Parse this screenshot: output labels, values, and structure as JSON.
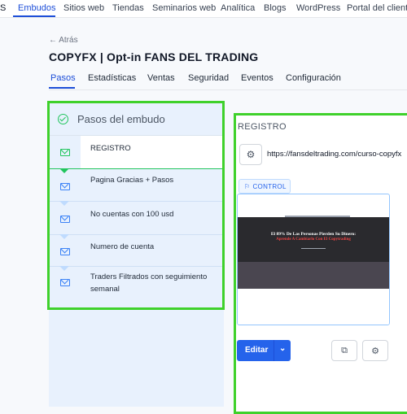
{
  "topnav": {
    "cut_label": "S",
    "items": [
      "Embudos",
      "Sitios web",
      "Tiendas",
      "Seminarios web",
      "Analítica",
      "Blogs",
      "WordPress",
      "Portal del cliente"
    ]
  },
  "page": {
    "back_label": "← Atrás",
    "title": "COPYFX | Opt-in FANS DEL TRADING",
    "tabs": [
      "Pasos",
      "Estadísticas",
      "Ventas",
      "Seguridad",
      "Eventos",
      "Configuración"
    ]
  },
  "steps": {
    "header": "Pasos del embudo",
    "items": [
      {
        "label": "REGISTRO"
      },
      {
        "label": "Pagina Gracias + Pasos"
      },
      {
        "label": "No cuentas con 100 usd"
      },
      {
        "label": "Numero de cuenta"
      },
      {
        "label": "Traders Filtrados con seguimiento semanal"
      }
    ]
  },
  "detail": {
    "title": "REGISTRO",
    "url": "https://fansdeltrading.com/curso-copyfx",
    "control_badge": "CONTROL",
    "preview": {
      "headline": "El 89% De Las Personas Pierden Su Dinero:",
      "subheadline": "Aprende A Cambiarlo Con El Copytrading"
    },
    "edit_label": "Editar"
  },
  "colors": {
    "accent": "#2563eb",
    "highlight": "#3fd12b",
    "steps_bg": "#e8f1fd"
  }
}
